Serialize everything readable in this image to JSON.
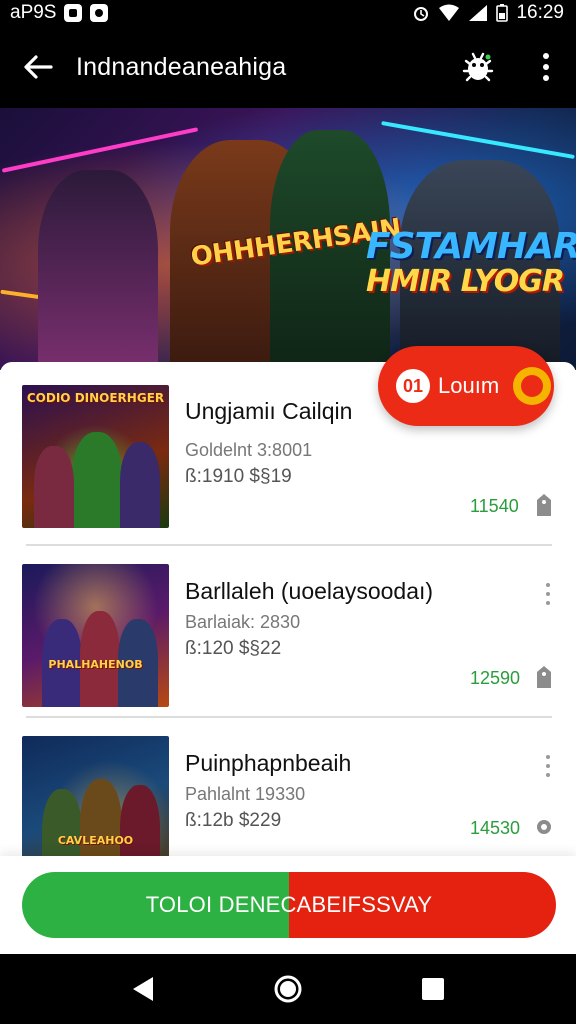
{
  "status_bar": {
    "left_text": "аP9S",
    "time": "16:29"
  },
  "app_bar": {
    "title": "Indnandeaneahiga",
    "back_icon": "arrow-left-icon",
    "bug_icon": "bug-icon",
    "more_icon": "more-vert-icon"
  },
  "hero": {
    "title_left": "OHHHERHSAIN",
    "title_right_line1": "FSTAMHAR",
    "title_right_line2": "HMIR LYOGR"
  },
  "login": {
    "label": "Louım"
  },
  "items": [
    {
      "thumb_logo": "CODIO DINOERHGER",
      "title": "Ungjamiı Cailqin",
      "subtitle": "Goldelnt 3:8001",
      "meta": "ß:1910 $§19",
      "price": "11540"
    },
    {
      "thumb_logo": "PHALHAHENOB",
      "title": "Barllaleh (uoelaysoodaı)",
      "subtitle": "Barlaiak: 2830",
      "meta": "ß:120 $§22",
      "price": "12590"
    },
    {
      "thumb_logo": "CAVLEAHOO",
      "title": "Puinphapnbeaih",
      "subtitle": "Pahlalnt 19330",
      "meta": "ß:12b $229",
      "price": "14530"
    }
  ],
  "cta": {
    "label": "TOLOI DENECABEIFSSVAY"
  },
  "colors": {
    "accent_red": "#e4220f",
    "accent_green": "#2db142",
    "price_green": "#2a9d3c"
  },
  "nav": {
    "back_icon": "triangle-back-icon",
    "home_icon": "circle-home-icon",
    "recents_icon": "square-recents-icon"
  }
}
